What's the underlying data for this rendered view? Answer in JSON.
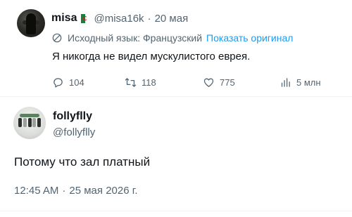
{
  "tweet": {
    "name": "misa",
    "handle": "@misa16k",
    "separator": "·",
    "date": "20 мая",
    "translation_note": "Исходный язык: Французский",
    "show_original": "Показать оригинал",
    "text": "Я никогда не видел мускулистого еврея.",
    "actions": {
      "replies": "104",
      "retweets": "118",
      "likes": "775",
      "views": "5 млн"
    },
    "icons": [
      "flag-icon",
      "globe-icon",
      "reply-icon",
      "retweet-icon",
      "like-icon",
      "views-icon"
    ]
  },
  "reply": {
    "name": "follyflly",
    "handle": "@follyflly",
    "text": "Потому что зал платный",
    "time": "12:45 AM",
    "separator": "·",
    "date": "25 мая 2026 г."
  },
  "colors": {
    "text": "#0f1419",
    "secondary": "#536471",
    "link": "#1d9bf0",
    "divider": "#eff3f4"
  }
}
